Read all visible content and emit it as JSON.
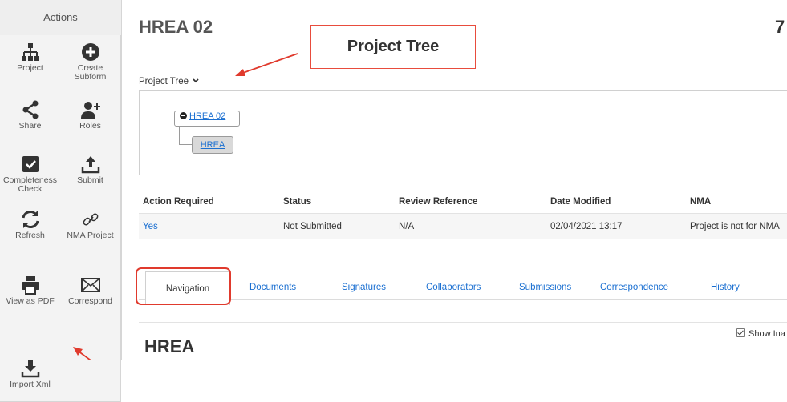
{
  "sidebar": {
    "heading": "Actions",
    "items": [
      {
        "label": "Project",
        "icon": "hierarchy-icon"
      },
      {
        "label": "Create Subform",
        "icon": "plus-circle-icon"
      },
      {
        "label": "Share",
        "icon": "share-icon"
      },
      {
        "label": "Roles",
        "icon": "add-user-icon"
      },
      {
        "label": "Completeness Check",
        "icon": "checkbox-icon"
      },
      {
        "label": "Submit",
        "icon": "upload-icon"
      },
      {
        "label": "Refresh",
        "icon": "refresh-icon"
      },
      {
        "label": "NMA Project",
        "icon": "link-icon"
      },
      {
        "label": "View as PDF",
        "icon": "printer-icon"
      },
      {
        "label": "Correspond",
        "icon": "envelope-icon"
      },
      {
        "label": "Import Xml",
        "icon": "download-icon"
      }
    ]
  },
  "header": {
    "title": "HREA 02",
    "number_fragment": "7"
  },
  "callout": {
    "text": "Project Tree"
  },
  "project_tree": {
    "label": "Project Tree",
    "root": "HREA 02",
    "child": "HREA"
  },
  "table": {
    "headers": [
      "Action Required",
      "Status",
      "Review Reference",
      "Date Modified",
      "NMA"
    ],
    "row": [
      "Yes",
      "Not Submitted",
      "N/A",
      "02/04/2021 13:17",
      "Project is not for NMA"
    ]
  },
  "tabs": [
    "Navigation",
    "Documents",
    "Signatures",
    "Collaborators",
    "Submissions",
    "Correspondence",
    "History"
  ],
  "panel": {
    "show_toggle": "Show Ina",
    "heading": "HREA"
  },
  "colors": {
    "annotation_red": "#e03a2d",
    "link_blue": "#1a6fd1",
    "sidebar_bg": "#f3f3f3"
  }
}
